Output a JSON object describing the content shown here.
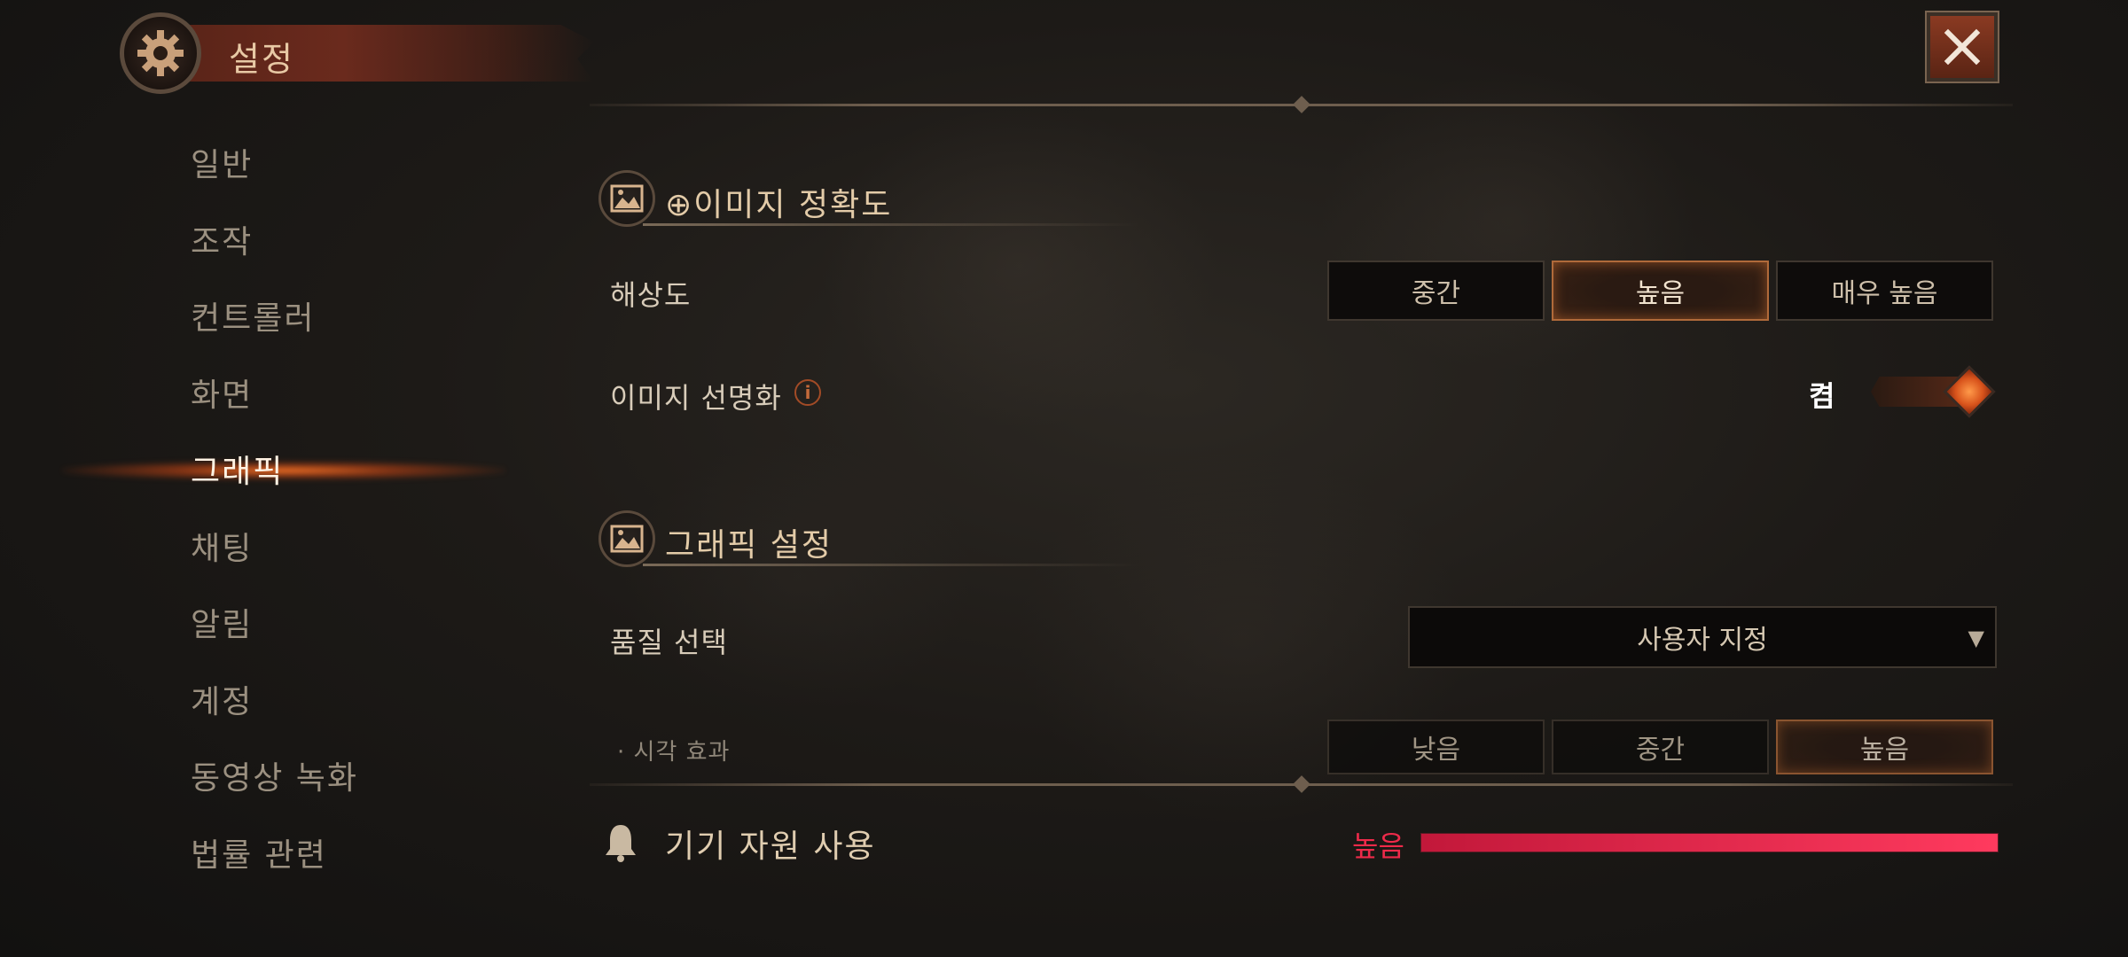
{
  "header": {
    "title": "설정"
  },
  "sidebar": {
    "items": [
      {
        "label": "일반"
      },
      {
        "label": "조작"
      },
      {
        "label": "컨트롤러"
      },
      {
        "label": "화면"
      },
      {
        "label": "그래픽"
      },
      {
        "label": "채팅"
      },
      {
        "label": "알림"
      },
      {
        "label": "계정"
      },
      {
        "label": "동영상 녹화"
      },
      {
        "label": "법률 관련"
      }
    ],
    "active": "그래픽"
  },
  "image_accuracy": {
    "title": "⊕이미지 정확도",
    "resolution": {
      "label": "해상도",
      "options": [
        "중간",
        "높음",
        "매우 높음"
      ],
      "selected": "높음"
    },
    "sharpening": {
      "label": "이미지 선명화",
      "info_icon": "info-icon",
      "state_label": "켬",
      "enabled": true
    }
  },
  "graphics_settings": {
    "title": "그래픽 설정",
    "quality": {
      "label": "품질 선택",
      "value": "사용자 지정"
    },
    "visual_effects": {
      "label": "· 시각 효과",
      "options": [
        "낮음",
        "중간",
        "높음"
      ],
      "selected": "높음"
    }
  },
  "device_resources": {
    "title": "기기 자원 사용",
    "level_label": "높음",
    "level_fraction": 1.0
  },
  "colors": {
    "accent_orange": "#d9541c",
    "usage_red": "#ee2a4a",
    "text_gold": "#e3cba8"
  },
  "icons": {
    "header": "gear-icon",
    "close": "close-icon",
    "section": "image-frame-icon",
    "resource": "bell-icon"
  }
}
